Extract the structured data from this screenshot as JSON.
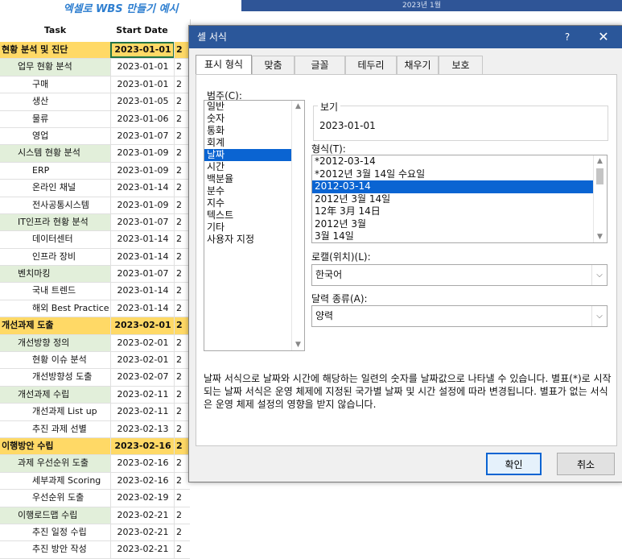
{
  "sheet": {
    "title": "엑셀로 WBS 만들기 예시",
    "top_band_text": "2023년 1월",
    "headers": {
      "task": "Task",
      "start_date": "Start Date",
      "extra": ""
    },
    "rows": [
      {
        "task": "현황 분석 및 진단",
        "date": "2023-01-01",
        "extra": "2",
        "level": 0
      },
      {
        "task": "업무 현황 분석",
        "date": "2023-01-01",
        "extra": "2",
        "level": 1
      },
      {
        "task": "구매",
        "date": "2023-01-01",
        "extra": "2",
        "level": 2
      },
      {
        "task": "생산",
        "date": "2023-01-05",
        "extra": "2",
        "level": 2
      },
      {
        "task": "물류",
        "date": "2023-01-06",
        "extra": "2",
        "level": 2
      },
      {
        "task": "영업",
        "date": "2023-01-07",
        "extra": "2",
        "level": 2
      },
      {
        "task": "시스템 현황 분석",
        "date": "2023-01-09",
        "extra": "2",
        "level": 1
      },
      {
        "task": "ERP",
        "date": "2023-01-09",
        "extra": "2",
        "level": 2
      },
      {
        "task": "온라인 채널",
        "date": "2023-01-14",
        "extra": "2",
        "level": 2
      },
      {
        "task": "전사공통시스템",
        "date": "2023-01-09",
        "extra": "2",
        "level": 2
      },
      {
        "task": "IT인프라 현황 분석",
        "date": "2023-01-07",
        "extra": "2",
        "level": 1
      },
      {
        "task": "데이터센터",
        "date": "2023-01-14",
        "extra": "2",
        "level": 2
      },
      {
        "task": "인프라 장비",
        "date": "2023-01-14",
        "extra": "2",
        "level": 2
      },
      {
        "task": "벤치마킹",
        "date": "2023-01-07",
        "extra": "2",
        "level": 1
      },
      {
        "task": "국내 트렌드",
        "date": "2023-01-14",
        "extra": "2",
        "level": 2
      },
      {
        "task": "해외 Best Practice",
        "date": "2023-01-14",
        "extra": "2",
        "level": 2
      },
      {
        "task": "개선과제 도출",
        "date": "2023-02-01",
        "extra": "2",
        "level": 0
      },
      {
        "task": "개선방향 정의",
        "date": "2023-02-01",
        "extra": "2",
        "level": 1
      },
      {
        "task": "현황 이슈 분석",
        "date": "2023-02-01",
        "extra": "2",
        "level": 2
      },
      {
        "task": "개선방향성 도출",
        "date": "2023-02-07",
        "extra": "2",
        "level": 2
      },
      {
        "task": "개선과제 수립",
        "date": "2023-02-11",
        "extra": "2",
        "level": 1
      },
      {
        "task": "개선과제 List up",
        "date": "2023-02-11",
        "extra": "2",
        "level": 2
      },
      {
        "task": "추진 과제 선별",
        "date": "2023-02-13",
        "extra": "2",
        "level": 2
      },
      {
        "task": "이행방안 수립",
        "date": "2023-02-16",
        "extra": "2",
        "level": 0
      },
      {
        "task": "과제 우선순위 도출",
        "date": "2023-02-16",
        "extra": "2",
        "level": 1
      },
      {
        "task": "세부과제 Scoring",
        "date": "2023-02-16",
        "extra": "2",
        "level": 2
      },
      {
        "task": "우선순위 도출",
        "date": "2023-02-19",
        "extra": "2",
        "level": 2
      },
      {
        "task": "이행로드맵 수립",
        "date": "2023-02-21",
        "extra": "2",
        "level": 1
      },
      {
        "task": "추진 일정 수립",
        "date": "2023-02-21",
        "extra": "2",
        "level": 2
      },
      {
        "task": "추진 방안 작성",
        "date": "2023-02-21",
        "extra": "2",
        "level": 2
      }
    ]
  },
  "dialog": {
    "title": "셀 서식",
    "help": "?",
    "close": "✕",
    "tabs": [
      "표시 형식",
      "맞춤",
      "글꼴",
      "테두리",
      "채우기",
      "보호"
    ],
    "active_tab": 0,
    "category_label": "범주(C):",
    "categories": [
      "일반",
      "숫자",
      "통화",
      "회계",
      "날짜",
      "시간",
      "백분율",
      "분수",
      "지수",
      "텍스트",
      "기타",
      "사용자 지정"
    ],
    "selected_category": 4,
    "sample_label": "보기",
    "sample_value": "2023-01-01",
    "format_label": "형식(T):",
    "formats": [
      "*2012-03-14",
      "*2012년 3월 14일 수요일",
      "2012-03-14",
      "2012년 3월 14일",
      "12年 3月 14日",
      "2012년 3월",
      "3월 14일"
    ],
    "selected_format": 2,
    "locale_label": "로캘(위치)(L):",
    "locale_value": "한국어",
    "calendar_label": "달력 종류(A):",
    "calendar_value": "양력",
    "description": "날짜 서식으로 날짜와 시간에 해당하는 일련의 숫자를 날짜값으로 나타낼 수 있습니다. 별표(*)로 시작되는 날짜 서식은 운영 체제에 지정된 국가별 날짜 및 시간 설정에 따라 변경됩니다. 별표가 없는 서식은 운영 체제 설정의 영향을 받지 않습니다.",
    "ok_label": "확인",
    "cancel_label": "취소"
  }
}
